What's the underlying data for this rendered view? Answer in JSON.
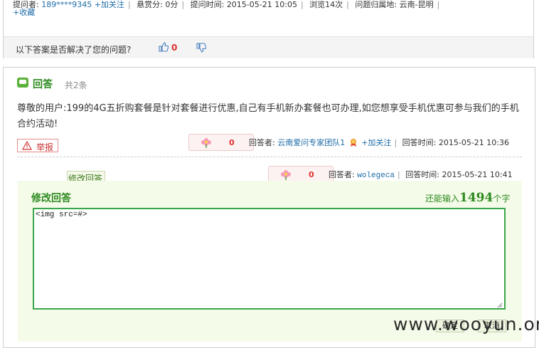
{
  "question_meta": {
    "asker_label": "提问者:",
    "asker_name": "189****9345",
    "follow_label": "+加关注",
    "bounty_label": "悬赏分:",
    "bounty_value": "0分",
    "time_label": "提问时间:",
    "time_value": "2015-05-21 10:05",
    "views": "浏览14次",
    "region_label": "问题归属地:",
    "region_value": "云南-昆明",
    "favorite_label": "+收藏"
  },
  "helpful_bar": {
    "question_text": "以下答案是否解决了您的问题?",
    "thumbs_up_count": "0"
  },
  "answers_header": {
    "title": "回答",
    "count_text": "共2条"
  },
  "answer1": {
    "text": "尊敬的用户:199的4G五折购套餐是针对套餐进行优惠,自己有手机新办套餐也可办理,如您想享受手机优惠可参与我们的手机合约活动!",
    "report_label": "举报",
    "flower_count": "0",
    "answerer_label": "回答者:",
    "answerer_name": "云南爱问专家团队1",
    "follow_label": "+加关注",
    "time_label": "回答时间:",
    "time_value": "2015-05-21 10:36"
  },
  "answer2": {
    "edit_link": "修改回答",
    "flower_count": "0",
    "answerer_label": "回答者:",
    "answerer_name": "wolegeca",
    "time_label": "回答时间:",
    "time_value": "2015-05-21 10:41"
  },
  "edit_form": {
    "title": "修改回答",
    "remain_prefix": "还能输入",
    "remain_count": "1494",
    "remain_suffix": "个字",
    "textarea_value": "<img src=#>",
    "bottom_buttons": [
      "确定",
      "取消"
    ]
  },
  "watermark": "www.wooyun.org",
  "colors": {
    "green_title": "#2c8a1f",
    "link_blue": "#1d6ca8",
    "count_red": "#e03030",
    "edit_bg": "#f5fbe9",
    "textarea_border": "#3aa64a"
  }
}
